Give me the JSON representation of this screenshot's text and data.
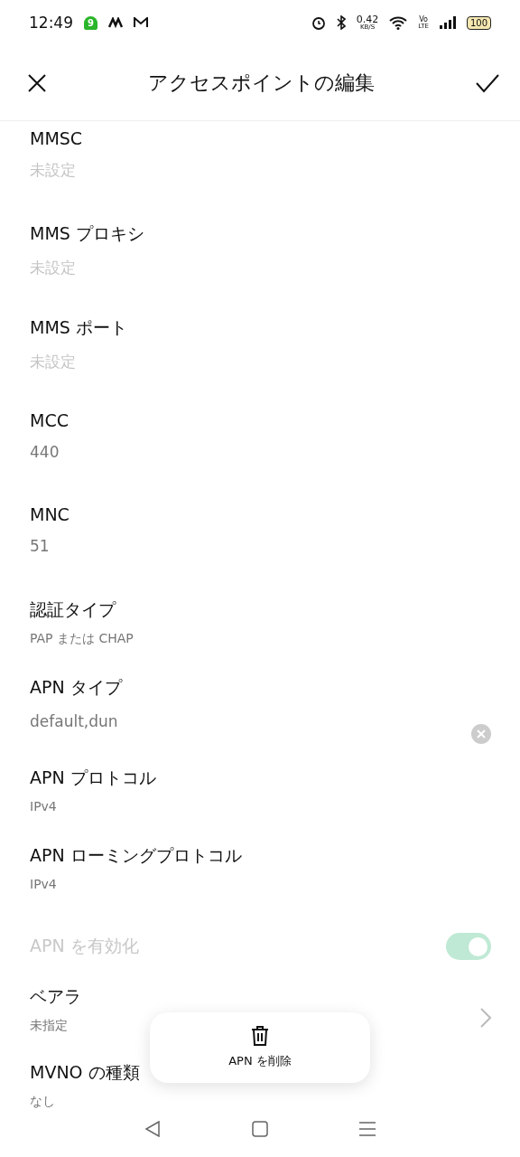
{
  "status_bar": {
    "time": "12:49",
    "badge": "9",
    "speed": "0.42",
    "speed_unit": "KB/S",
    "volte_top": "Vo",
    "volte_bottom": "LTE",
    "battery": "100"
  },
  "header": {
    "title": "アクセスポイントの編集"
  },
  "rows": [
    {
      "kind": "field",
      "label": "MMSC",
      "placeholder": "未設定"
    },
    {
      "kind": "field",
      "label": "MMS プロキシ",
      "placeholder": "未設定"
    },
    {
      "kind": "field",
      "label": "MMS ポート",
      "placeholder": "未設定"
    },
    {
      "kind": "field",
      "label": "MCC",
      "value": "440"
    },
    {
      "kind": "field",
      "label": "MNC",
      "value": "51"
    },
    {
      "kind": "select",
      "label": "認証タイプ",
      "value": "PAP または CHAP"
    },
    {
      "kind": "field",
      "label": "APN タイプ",
      "value": "default,dun",
      "clearable": true
    },
    {
      "kind": "select",
      "label": "APN プロトコル",
      "value": "IPv4"
    },
    {
      "kind": "select",
      "label": "APN ローミングプロトコル",
      "value": "IPv4"
    },
    {
      "kind": "toggle",
      "label": "APN を有効化",
      "on": true,
      "disabled": true
    },
    {
      "kind": "chevron",
      "label": "ベアラ",
      "value": "未指定"
    },
    {
      "kind": "select",
      "label": "MVNO の種類",
      "value": "なし"
    }
  ],
  "delete_popup": {
    "label": "APN を削除"
  }
}
